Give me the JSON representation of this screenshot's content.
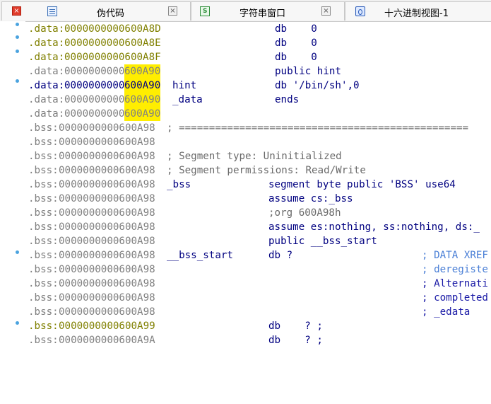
{
  "tabs": [
    {
      "label": "伪代码",
      "close": "×",
      "active": true
    },
    {
      "label": "字符串窗口",
      "close": "×",
      "active": false
    },
    {
      "label": "十六进制视图-1",
      "close": "",
      "active": false
    }
  ],
  "colors": {
    "highlight": "#ffee00",
    "data_addr": "#808000",
    "bss_addr": "#808080",
    "keyword": "#000080",
    "comment": "#6a6a6a",
    "xref_comment": "#4a7fd6"
  },
  "lines": [
    {
      "seg": ".data:",
      "addr": "0000000000600A8D",
      "hl": "",
      "c1": "",
      "c2": "db    0",
      "c3": ""
    },
    {
      "seg": ".data:",
      "addr": "0000000000600A8E",
      "hl": "",
      "c1": "",
      "c2": "db    0",
      "c3": ""
    },
    {
      "seg": ".data:",
      "addr": "0000000000600A8F",
      "hl": "",
      "c1": "",
      "c2": "db    0",
      "c3": ""
    },
    {
      "seg": ".data:",
      "addr": "0000000000",
      "hl": "600A90",
      "c1": "",
      "c2": "public hint",
      "c3": ""
    },
    {
      "seg": ".data:",
      "addr": "0000000000",
      "hl": "600A90",
      "c1": "hint",
      "c2": "db '/bin/sh',0",
      "c3": ""
    },
    {
      "seg": ".data:",
      "addr": "0000000000",
      "hl": "600A90",
      "c1": "_data",
      "c2": "ends",
      "c3": ""
    },
    {
      "seg": ".data:",
      "addr": "0000000000",
      "hl": "600A90",
      "c1": "",
      "c2": "",
      "c3": ""
    },
    {
      "seg": ".bss:",
      "addr": "0000000000600A98",
      "hl": "",
      "c1": "; ================================================",
      "c2": "",
      "c3": ""
    },
    {
      "seg": ".bss:",
      "addr": "0000000000600A98",
      "hl": "",
      "c1": "",
      "c2": "",
      "c3": ""
    },
    {
      "seg": ".bss:",
      "addr": "0000000000600A98",
      "hl": "",
      "c1": "; Segment type: Uninitialized",
      "c2": "",
      "c3": ""
    },
    {
      "seg": ".bss:",
      "addr": "0000000000600A98",
      "hl": "",
      "c1": "; Segment permissions: Read/Write",
      "c2": "",
      "c3": ""
    },
    {
      "seg": ".bss:",
      "addr": "0000000000600A98",
      "hl": "",
      "c1": "_bss",
      "c2": "segment byte public 'BSS' use64",
      "c3": ""
    },
    {
      "seg": ".bss:",
      "addr": "0000000000600A98",
      "hl": "",
      "c1": "",
      "c2": "assume cs:_bss",
      "c3": ""
    },
    {
      "seg": ".bss:",
      "addr": "0000000000600A98",
      "hl": "",
      "c1": "",
      "c2": ";org 600A98h",
      "c3": ""
    },
    {
      "seg": ".bss:",
      "addr": "0000000000600A98",
      "hl": "",
      "c1": "",
      "c2": "assume es:nothing, ss:nothing, ds:_",
      "c3": ""
    },
    {
      "seg": ".bss:",
      "addr": "0000000000600A98",
      "hl": "",
      "c1": "",
      "c2": "public __bss_start",
      "c3": ""
    },
    {
      "seg": ".bss:",
      "addr": "0000000000600A98",
      "hl": "",
      "c1": "__bss_start",
      "c2": "db ?",
      "c3": "; DATA XREF"
    },
    {
      "seg": ".bss:",
      "addr": "0000000000600A98",
      "hl": "",
      "c1": "",
      "c2": "",
      "c3": "; deregiste"
    },
    {
      "seg": ".bss:",
      "addr": "0000000000600A98",
      "hl": "",
      "c1": "",
      "c2": "",
      "c3": "; Alternati"
    },
    {
      "seg": ".bss:",
      "addr": "0000000000600A98",
      "hl": "",
      "c1": "",
      "c2": "",
      "c3": "; completed"
    },
    {
      "seg": ".bss:",
      "addr": "0000000000600A98",
      "hl": "",
      "c1": "",
      "c2": "",
      "c3": "; _edata"
    },
    {
      "seg": ".bss:",
      "addr": "0000000000600A99",
      "hl": "",
      "c1": "",
      "c2": "db    ? ;",
      "c3": ""
    },
    {
      "seg": ".bss:",
      "addr": "0000000000600A9A",
      "hl": "",
      "c1": "",
      "c2": "db    ? ;",
      "c3": ""
    }
  ]
}
